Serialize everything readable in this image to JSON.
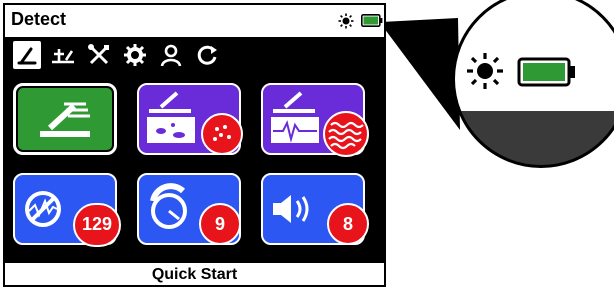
{
  "screen": {
    "title": "Detect",
    "footer": "Quick Start"
  },
  "status": {
    "brightness_icon": "sun-icon",
    "battery_icon": "battery-icon",
    "battery_color": "#2f9a34"
  },
  "tabs": [
    {
      "icon": "detect-tab-icon",
      "active": true
    },
    {
      "icon": "ground-balance-tab-icon",
      "active": false
    },
    {
      "icon": "tools-tab-icon",
      "active": false
    },
    {
      "icon": "settings-gear-icon",
      "active": false
    },
    {
      "icon": "user-profile-icon",
      "active": false
    },
    {
      "icon": "reset-icon",
      "active": false
    }
  ],
  "tiles": [
    {
      "name": "detect-mode-tile",
      "icon": "coil-sweep-icon",
      "color": "#2f9a34"
    },
    {
      "name": "ground-type-tile",
      "icon": "mineralized-ground-icon",
      "color": "#6a2bd8",
      "badge_icon": "ground-particles-icon"
    },
    {
      "name": "signal-tile",
      "icon": "audio-signal-icon",
      "color": "#6a2bd8",
      "badge_icon": "wave-pattern-icon"
    },
    {
      "name": "noise-cancel-tile",
      "icon": "noise-cancel-icon",
      "color": "#2d57f2",
      "badge": "129"
    },
    {
      "name": "sensitivity-tile",
      "icon": "sensitivity-dial-icon",
      "color": "#2d57f2",
      "badge": "9"
    },
    {
      "name": "volume-tile",
      "icon": "speaker-icon",
      "color": "#2d57f2",
      "badge": "8"
    }
  ],
  "colors": {
    "badge": "#e8141b",
    "purple": "#6a2bd8",
    "blue": "#2d57f2",
    "green": "#2f9a34"
  }
}
